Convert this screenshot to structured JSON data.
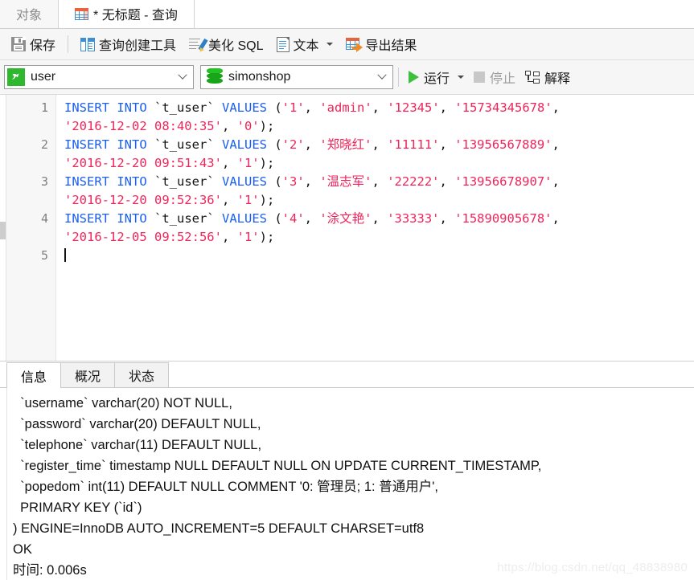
{
  "tabbar": {
    "object_tab": "对象",
    "query_tab": "* 无标题 - 查询",
    "query_tab_icon": "grid-table-icon"
  },
  "toolbar": {
    "save": "保存",
    "query_builder": "查询创建工具",
    "beautify_sql": "美化 SQL",
    "text": "文本",
    "export_result": "导出结果"
  },
  "selectors": {
    "connection": "user",
    "connection_icon": "mysql-dolphin-icon",
    "database": "simonshop",
    "database_icon": "database-cylinder-icon",
    "run": "运行",
    "stop": "停止",
    "explain": "解释"
  },
  "editor": {
    "line_numbers": [
      "1",
      "2",
      "3",
      "4",
      "5"
    ],
    "statements": [
      {
        "num": "1",
        "keyword1": "INSERT INTO",
        "table": "`t_user`",
        "keyword2": "VALUES",
        "open": " (",
        "values": [
          "'1'",
          "'admin'",
          "'12345'",
          "'15734345678'"
        ],
        "cont_values": [
          "'2016-12-02 08:40:35'",
          "'0'"
        ],
        "close": ");"
      },
      {
        "num": "2",
        "keyword1": "INSERT INTO",
        "table": "`t_user`",
        "keyword2": "VALUES",
        "open": " (",
        "values": [
          "'2'",
          "'郑晓红'",
          "'11111'",
          "'13956567889'"
        ],
        "cont_values": [
          "'2016-12-20 09:51:43'",
          "'1'"
        ],
        "close": ");"
      },
      {
        "num": "3",
        "keyword1": "INSERT INTO",
        "table": "`t_user`",
        "keyword2": "VALUES",
        "open": " (",
        "values": [
          "'3'",
          "'温志军'",
          "'22222'",
          "'13956678907'"
        ],
        "cont_values": [
          "'2016-12-20 09:52:36'",
          "'1'"
        ],
        "close": ");"
      },
      {
        "num": "4",
        "keyword1": "INSERT INTO",
        "table": "`t_user`",
        "keyword2": "VALUES",
        "open": " (",
        "values": [
          "'4'",
          "'涂文艳'",
          "'33333'",
          "'15890905678'"
        ],
        "cont_values": [
          "'2016-12-05 09:52:56'",
          "'1'"
        ],
        "close": ");"
      }
    ]
  },
  "results": {
    "tabs": [
      {
        "label": "信息",
        "active": true
      },
      {
        "label": "概况",
        "active": false
      },
      {
        "label": "状态",
        "active": false
      }
    ],
    "output_lines": [
      "  `username` varchar(20) NOT NULL,",
      "  `password` varchar(20) DEFAULT NULL,",
      "  `telephone` varchar(11) DEFAULT NULL,",
      "  `register_time` timestamp NULL DEFAULT NULL ON UPDATE CURRENT_TIMESTAMP,",
      "  `popedom` int(11) DEFAULT NULL COMMENT '0: 管理员; 1: 普通用户',",
      "  PRIMARY KEY (`id`)",
      ") ENGINE=InnoDB AUTO_INCREMENT=5 DEFAULT CHARSET=utf8",
      "OK",
      "时间: 0.006s"
    ]
  },
  "watermark": "https://blog.csdn.net/qq_48838980",
  "colors": {
    "keyword": "#1a5ff0",
    "string": "#f0245a",
    "plain": "#111111",
    "toolbar_bg": "#f6f6f6",
    "accent_green": "#3fbf3f"
  }
}
